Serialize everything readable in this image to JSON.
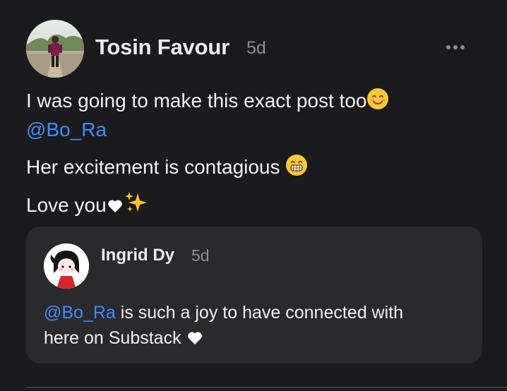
{
  "post": {
    "author": "Tosin Favour",
    "timestamp": "5d",
    "more_label": "More options",
    "lines": [
      "I was going to make this exact post too",
      "@Bo_Ra",
      "Her excitement is contagious ",
      "Love you"
    ]
  },
  "quote": {
    "author": "Ingrid Dy",
    "timestamp": "5d",
    "mention": "@Bo_Ra",
    "text_line1": " is such a joy to have connected with",
    "text_line2": "here on Substack "
  },
  "colors": {
    "background": "#1b1b1d",
    "card": "#2a2a2d",
    "mention": "#3d8dff",
    "muted": "#8e8e93"
  },
  "icons": {
    "more": "more-horizontal-icon",
    "smile": "smiling-face-icon",
    "grin": "grinning-face-icon",
    "heart": "white-heart-icon",
    "sparkles": "sparkles-icon"
  }
}
